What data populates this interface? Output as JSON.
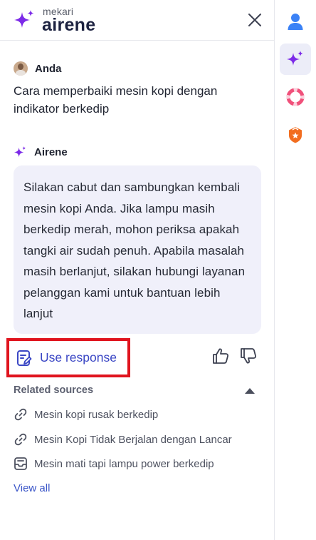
{
  "header": {
    "brand_small": "mekari",
    "brand_big": "airene",
    "close_icon": "close-icon"
  },
  "conversation": {
    "user_name": "Anda",
    "user_message": "Cara memperbaiki mesin kopi dengan indikator berkedip",
    "bot_name": "Airene",
    "bot_message": "Silakan cabut dan sambungkan kembali mesin kopi Anda. Jika lampu masih berkedip merah, mohon periksa apakah tangki air sudah penuh. Apabila masalah masih berlanjut, silakan hubungi layanan pelanggan kami untuk bantuan lebih lanjut"
  },
  "actions": {
    "use_response_label": "Use response",
    "thumbs_up_icon": "thumbs-up-icon",
    "thumbs_down_icon": "thumbs-down-icon"
  },
  "related": {
    "title": "Related sources",
    "items": [
      {
        "label": "Mesin kopi rusak berkedip",
        "icon": "link-icon"
      },
      {
        "label": "Mesin Kopi Tidak Berjalan dengan Lancar",
        "icon": "link-icon"
      },
      {
        "label": "Mesin mati tapi lampu power berkedip",
        "icon": "inbox-icon"
      }
    ],
    "view_all": "View all"
  },
  "rail": [
    {
      "name": "profile",
      "icon": "person-icon",
      "color": "#3b82f6"
    },
    {
      "name": "airene",
      "icon": "sparkle-icon",
      "color": "#7c2ae8",
      "active": true
    },
    {
      "name": "support",
      "icon": "lifebuoy-icon",
      "color": "#f0507a"
    },
    {
      "name": "badge",
      "icon": "shield-star-icon",
      "color": "#f26d1f"
    }
  ],
  "colors": {
    "accent": "#3a46c4",
    "sparkle": "#7c2ae8",
    "bubble_bg": "#f0f0fa",
    "highlight_border": "#e0141e"
  }
}
